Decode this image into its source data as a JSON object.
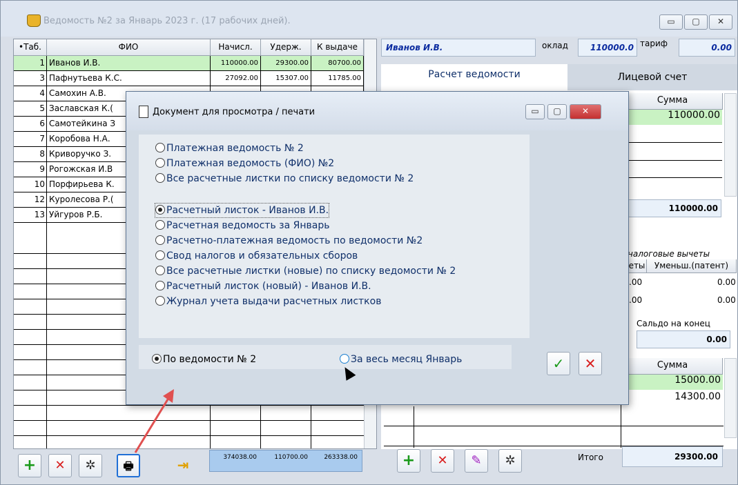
{
  "window": {
    "title": "Ведомость №2 за Январь 2023 г. (17 рабочих дней).",
    "min": "▭",
    "max": "▢",
    "close": "✕"
  },
  "table": {
    "headers": {
      "tab": "•Таб.",
      "fio": "ФИО",
      "accrued": "Начисл.",
      "withheld": "Удерж.",
      "payout": "К выдаче"
    },
    "rows": [
      {
        "tab": "1",
        "fio": "Иванов И.В.",
        "accrued": "110000.00",
        "withheld": "29300.00",
        "payout": "80700.00"
      },
      {
        "tab": "3",
        "fio": "Пафнутьева К.С.",
        "accrued": "27092.00",
        "withheld": "15307.00",
        "payout": "11785.00"
      },
      {
        "tab": "4",
        "fio": "Самохин А.В.",
        "accrued": "",
        "withheld": "",
        "payout": ""
      },
      {
        "tab": "5",
        "fio": "Заславская К.(",
        "accrued": "",
        "withheld": "",
        "payout": ""
      },
      {
        "tab": "6",
        "fio": "Самотейкина З",
        "accrued": "",
        "withheld": "",
        "payout": ""
      },
      {
        "tab": "7",
        "fio": "Коробова Н.А.",
        "accrued": "",
        "withheld": "",
        "payout": ""
      },
      {
        "tab": "8",
        "fio": "Криворучко З.",
        "accrued": "",
        "withheld": "",
        "payout": ""
      },
      {
        "tab": "9",
        "fio": "Рогожская И.В",
        "accrued": "",
        "withheld": "",
        "payout": ""
      },
      {
        "tab": "10",
        "fio": "Порфирьева К.",
        "accrued": "",
        "withheld": "",
        "payout": ""
      },
      {
        "tab": "12",
        "fio": "Куролесова Р.(",
        "accrued": "",
        "withheld": "",
        "payout": ""
      },
      {
        "tab": "13",
        "fio": "Уйгуров Р.Б.",
        "accrued": "",
        "withheld": "",
        "payout": ""
      }
    ],
    "totals": {
      "accrued": "374038.00",
      "withheld": "110700.00",
      "payout": "263338.00"
    }
  },
  "employee": {
    "name": "Иванов И.В.",
    "salary_label": "оклад",
    "salary": "110000.0",
    "rate_label": "тариф",
    "rate": "0.00"
  },
  "tabs": {
    "calc": "Расчет ведомости",
    "account": "Лицевой счет"
  },
  "right_panel": {
    "sum_header": "Сумма",
    "sum_value": "110000.00",
    "total_value": "110000.00",
    "tax_deductions": "налоговые вычеты",
    "col_a": "еты",
    "col_b": "Уменьш.(патент)",
    "r1a": ".00",
    "r1b": "0.00",
    "r2a": ".00",
    "r2b": "0.00",
    "saldo_label": "Сальдо на конец",
    "saldo_value": "0.00",
    "sum2_header": "Сумма",
    "sum2_v1": "15000.00",
    "sum2_v2": "14300.00",
    "itogo_label": "Итого",
    "itogo_value": "29300.00"
  },
  "dialog": {
    "title": "Документ для  просмотра / печати",
    "options": [
      "Платежная ведомость № 2",
      "Платежная ведомость (ФИО) №2",
      "Все расчетные листки по списку ведомости № 2",
      "Расчетный листок - Иванов И.В.",
      "Расчетная ведомость за Январь",
      "Расчетно-платежная ведомость по ведомости №2",
      "Свод налогов и обязательных сборов",
      "Все расчетные листки (новые) по списку ведомости № 2",
      "Расчетный листок (новый) - Иванов И.В.",
      "Журнал учета выдачи расчетных листков"
    ],
    "selected_option": 3,
    "scope_a": "По ведомости № 2",
    "scope_b": "За весь месяц Январь",
    "ok": "✓",
    "cancel": "✕"
  },
  "colors": {
    "accent_green": "#1a9a1a",
    "accent_red": "#d81e1e",
    "selected_row": "#c9f2c3",
    "dialog_close": "#d64040"
  }
}
